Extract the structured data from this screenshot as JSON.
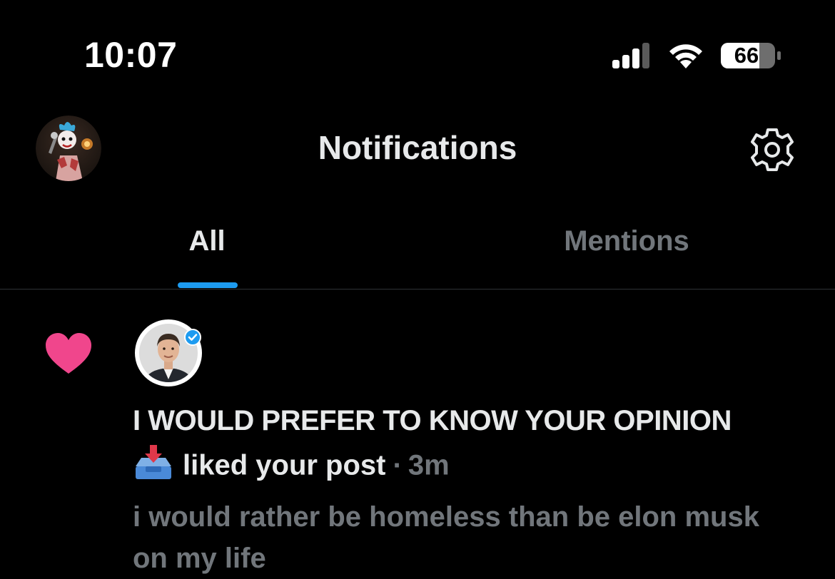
{
  "status_bar": {
    "time": "10:07",
    "battery": "66"
  },
  "header": {
    "title": "Notifications",
    "avatar_icon": "profile-avatar",
    "settings_icon": "gear-icon"
  },
  "tabs": [
    {
      "label": "All",
      "active": true
    },
    {
      "label": "Mentions",
      "active": false
    }
  ],
  "colors": {
    "accent": "#1d9bf0",
    "like": "#f0468c",
    "secondary_text": "#71767b"
  },
  "notification": {
    "type_icon": "heart-icon",
    "actor_name": "I WOULD PREFER TO KNOW YOUR OPINION",
    "emoji_icon": "inbox-tray-icon",
    "action": "liked your post",
    "separator": "·",
    "time_ago": "3m",
    "post_text": "i would rather be homeless than be elon musk on my life",
    "verified": true
  }
}
